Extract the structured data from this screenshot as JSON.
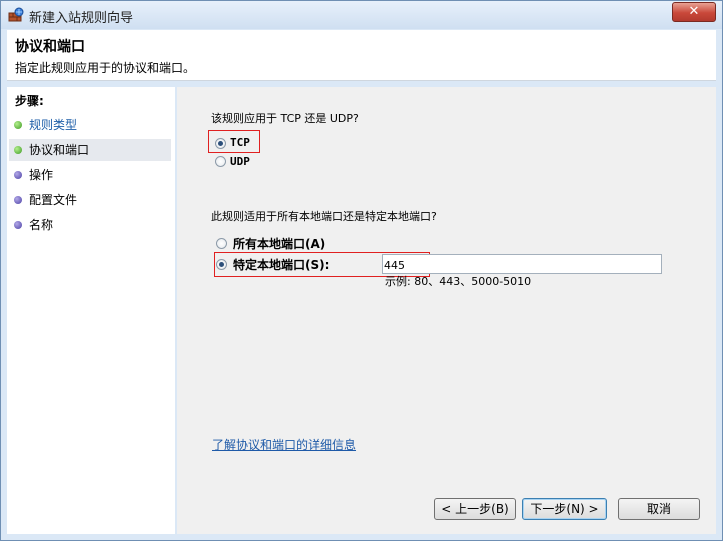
{
  "window": {
    "title": "新建入站规则向导",
    "close_glyph": "✕"
  },
  "header": {
    "title": "协议和端口",
    "description": "指定此规则应用于的协议和端口。"
  },
  "sidebar": {
    "label": "步骤:",
    "items": [
      {
        "label": "规则类型",
        "state": "done"
      },
      {
        "label": "协议和端口",
        "state": "current"
      },
      {
        "label": "操作",
        "state": "pending"
      },
      {
        "label": "配置文件",
        "state": "pending"
      },
      {
        "label": "名称",
        "state": "pending"
      }
    ]
  },
  "protocol": {
    "question": "该规则应用于 TCP 还是 UDP?",
    "tcp_label": "TCP",
    "udp_label": "UDP",
    "selected": "TCP"
  },
  "ports": {
    "question": "此规则适用于所有本地端口还是特定本地端口?",
    "all_label": "所有本地端口(A)",
    "specific_label": "特定本地端口(S):",
    "selected": "specific",
    "value": "445",
    "example": "示例: 80、443、5000-5010"
  },
  "link_text": "了解协议和端口的详细信息",
  "buttons": {
    "back": "< 上一步(B)",
    "next": "下一步(N) >",
    "cancel": "取消"
  },
  "colors": {
    "highlight_border": "#e02020",
    "link": "#1e5aa8"
  }
}
